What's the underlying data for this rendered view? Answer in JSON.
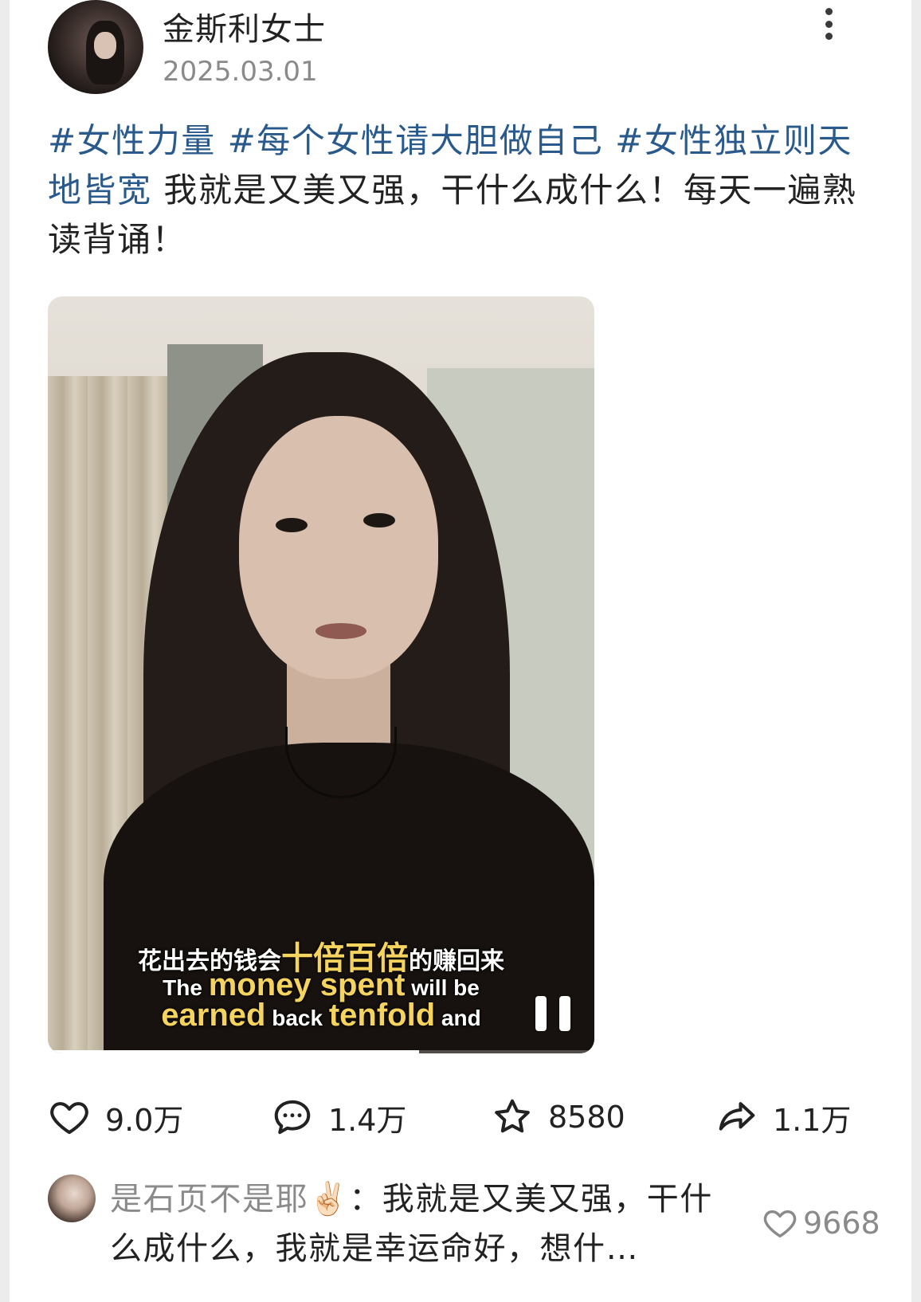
{
  "post": {
    "username": "金斯利女士",
    "date": "2025.03.01",
    "caption": {
      "tags": [
        "#女性力量",
        "#每个女性请大胆做自己",
        "#女性独立则天地皆宽"
      ],
      "text": "我就是又美又强，干什么成什么！每天一遍熟读背诵！"
    }
  },
  "video": {
    "subtitle_zh": {
      "pre": "花出去的钱会",
      "highlight": "十倍百倍",
      "post": "的赚回来"
    },
    "subtitle_en_line1": {
      "pre": "The ",
      "highlight": "money spent",
      "post": " will be"
    },
    "subtitle_en_line2": {
      "highlight1": "earned",
      "mid": " back ",
      "highlight2": "tenfold",
      "post": " and"
    },
    "progress_fraction": 0.68,
    "pause_icon": "pause-icon"
  },
  "actions": {
    "like_count": "9.0万",
    "comment_count": "1.4万",
    "favorite_count": "8580",
    "share_count": "1.1万"
  },
  "top_comment": {
    "name": "是石页不是耶",
    "emoji": "✌🏻",
    "text": "：我就是又美又强，干什么成什么，我就是幸运命好，想什…",
    "like_count": "9668"
  },
  "colors": {
    "tag": "#2a5a8c",
    "secondary_text": "#8a8a8a",
    "subtitle_highlight": "#f4d35e"
  }
}
